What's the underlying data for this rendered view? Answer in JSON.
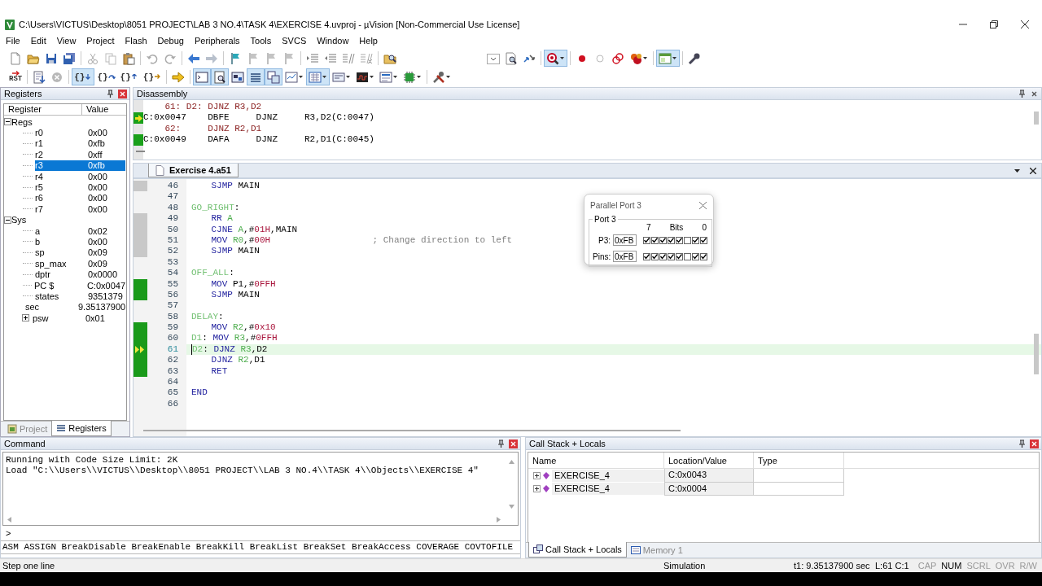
{
  "window": {
    "title": "C:\\Users\\VICTUS\\Desktop\\8051 PROJECT\\LAB 3 NO.4\\TASK 4\\EXERCISE 4.uvproj - µVision  [Non-Commercial Use License]"
  },
  "menu": [
    "File",
    "Edit",
    "View",
    "Project",
    "Flash",
    "Debug",
    "Peripherals",
    "Tools",
    "SVCS",
    "Window",
    "Help"
  ],
  "toolbars": [
    [
      {
        "kind": "new",
        "pressed": false,
        "dropdown": false
      },
      {
        "kind": "open",
        "pressed": false,
        "dropdown": false
      },
      {
        "kind": "save",
        "pressed": false,
        "dropdown": false
      },
      {
        "kind": "saveall",
        "pressed": false,
        "dropdown": false
      },
      {
        "kind": "sep"
      },
      {
        "kind": "cut",
        "pressed": false,
        "dropdown": false
      },
      {
        "kind": "copy",
        "pressed": false,
        "dropdown": false
      },
      {
        "kind": "paste",
        "pressed": false,
        "dropdown": false
      },
      {
        "kind": "sep"
      },
      {
        "kind": "undo",
        "pressed": false,
        "dropdown": false
      },
      {
        "kind": "redo",
        "pressed": false,
        "dropdown": false
      },
      {
        "kind": "sep"
      },
      {
        "kind": "back",
        "pressed": false,
        "dropdown": false
      },
      {
        "kind": "forward",
        "pressed": false,
        "dropdown": false
      },
      {
        "kind": "sep"
      },
      {
        "kind": "flag",
        "pressed": false,
        "dropdown": false
      },
      {
        "kind": "flaggray",
        "pressed": false,
        "dropdown": false
      },
      {
        "kind": "flaggray",
        "pressed": false,
        "dropdown": false
      },
      {
        "kind": "flaggray",
        "pressed": false,
        "dropdown": false
      },
      {
        "kind": "sep"
      },
      {
        "kind": "indent",
        "pressed": false,
        "dropdown": false
      },
      {
        "kind": "outdent",
        "pressed": false,
        "dropdown": false
      },
      {
        "kind": "comment",
        "pressed": false,
        "dropdown": false
      },
      {
        "kind": "uncomment",
        "pressed": false,
        "dropdown": false
      },
      {
        "kind": "sep"
      },
      {
        "kind": "findfiles",
        "pressed": false,
        "dropdown": false
      },
      {
        "kind": "spacer"
      },
      {
        "kind": "combo",
        "pressed": false,
        "dropdown": false
      },
      {
        "kind": "find",
        "pressed": false,
        "dropdown": false
      },
      {
        "kind": "arrows",
        "pressed": false,
        "dropdown": false
      },
      {
        "kind": "sep"
      },
      {
        "kind": "debug",
        "pressed": true,
        "dropdown": true
      },
      {
        "kind": "sep"
      },
      {
        "kind": "breakpoint",
        "pressed": false,
        "dropdown": false
      },
      {
        "kind": "circle",
        "pressed": false,
        "dropdown": false
      },
      {
        "kind": "linked",
        "pressed": false,
        "dropdown": false
      },
      {
        "kind": "multibreak",
        "pressed": false,
        "dropdown": true
      },
      {
        "kind": "sep"
      },
      {
        "kind": "window",
        "pressed": true,
        "dropdown": true
      },
      {
        "kind": "sep"
      },
      {
        "kind": "wrench",
        "pressed": false,
        "dropdown": false
      }
    ],
    [
      {
        "kind": "reset",
        "label": "RST",
        "pressed": false,
        "dropdown": false
      },
      {
        "kind": "sep"
      },
      {
        "kind": "load",
        "pressed": false,
        "dropdown": false
      },
      {
        "kind": "stop",
        "pressed": false,
        "dropdown": false
      },
      {
        "kind": "sep"
      },
      {
        "kind": "step_into",
        "label": "{}",
        "pressed": true,
        "dropdown": false
      },
      {
        "kind": "step_over",
        "label": "{}",
        "pressed": false,
        "dropdown": false
      },
      {
        "kind": "step_out",
        "label": "{}",
        "pressed": false,
        "dropdown": false
      },
      {
        "kind": "run_cursor",
        "label": "{}",
        "pressed": false,
        "dropdown": false
      },
      {
        "kind": "sep"
      },
      {
        "kind": "runarrow",
        "pressed": false,
        "dropdown": false
      },
      {
        "kind": "sep"
      },
      {
        "kind": "terminal",
        "pressed": true,
        "dropdown": false
      },
      {
        "kind": "disasm",
        "pressed": true,
        "dropdown": false
      },
      {
        "kind": "symbols",
        "pressed": false,
        "dropdown": false
      },
      {
        "kind": "registers",
        "pressed": true,
        "dropdown": false
      },
      {
        "kind": "callstack",
        "pressed": true,
        "dropdown": false
      },
      {
        "kind": "watch",
        "pressed": false,
        "dropdown": true
      },
      {
        "kind": "memory",
        "pressed": true,
        "dropdown": true
      },
      {
        "kind": "serial",
        "pressed": false,
        "dropdown": true
      },
      {
        "kind": "analyzer",
        "pressed": false,
        "dropdown": true
      },
      {
        "kind": "trace",
        "pressed": false,
        "dropdown": true
      },
      {
        "kind": "chip",
        "pressed": false,
        "dropdown": true
      },
      {
        "kind": "sep"
      },
      {
        "kind": "tools",
        "pressed": false,
        "dropdown": true
      }
    ]
  ],
  "registers": {
    "title": "Registers",
    "columns": [
      "Register",
      "Value"
    ],
    "groups": [
      {
        "name": "Regs",
        "expanded": true,
        "children": [
          {
            "name": "r0",
            "value": "0x00",
            "selected": false
          },
          {
            "name": "r1",
            "value": "0xfb",
            "selected": false
          },
          {
            "name": "r2",
            "value": "0xff",
            "selected": false
          },
          {
            "name": "r3",
            "value": "0xfb",
            "selected": true
          },
          {
            "name": "r4",
            "value": "0x00",
            "selected": false
          },
          {
            "name": "r5",
            "value": "0x00",
            "selected": false
          },
          {
            "name": "r6",
            "value": "0x00",
            "selected": false
          },
          {
            "name": "r7",
            "value": "0x00",
            "selected": false
          }
        ]
      },
      {
        "name": "Sys",
        "expanded": true,
        "children": [
          {
            "name": "a",
            "value": "0x02",
            "selected": false
          },
          {
            "name": "b",
            "value": "0x00",
            "selected": false
          },
          {
            "name": "sp",
            "value": "0x09",
            "selected": false
          },
          {
            "name": "sp_max",
            "value": "0x09",
            "selected": false
          },
          {
            "name": "dptr",
            "value": "0x0000",
            "selected": false
          },
          {
            "name": "PC  $",
            "value": "C:0x0047",
            "selected": false
          },
          {
            "name": "states",
            "value": "9351379",
            "selected": false
          },
          {
            "name": "sec",
            "value": "9.35137900",
            "selected": false
          },
          {
            "name": "psw",
            "value": "0x01",
            "selected": false,
            "expanded": false
          }
        ]
      }
    ],
    "tabs": [
      {
        "label": "Project",
        "selected": false
      },
      {
        "label": "Registers",
        "selected": true
      }
    ]
  },
  "disassembly": {
    "title": "Disassembly",
    "lines": [
      {
        "kind": "source",
        "number": "61:",
        "text": "D2: DJNZ R3,D2"
      },
      {
        "kind": "asm",
        "address": "C:0x0047",
        "opcode": "DBFE",
        "mnemonic": "DJNZ",
        "operands": "R3,D2(C:0047)",
        "current": true,
        "executed": true
      },
      {
        "kind": "source",
        "number": "62:",
        "text": "    DJNZ R2,D1"
      },
      {
        "kind": "asm",
        "address": "C:0x0049",
        "opcode": "DAFA",
        "mnemonic": "DJNZ",
        "operands": "R2,D1(C:0045)",
        "current": false,
        "executed": true
      }
    ]
  },
  "editor": {
    "tabs": [
      {
        "label": "Exercise 4.a51",
        "selected": true
      }
    ],
    "lines": [
      {
        "number": "46",
        "executed": false,
        "partial": true,
        "current": false,
        "indent": true,
        "tokens": [
          {
            "kind": "keyword",
            "text": "SJMP"
          },
          {
            "kind": "plain",
            "text": " MAIN"
          }
        ]
      },
      {
        "number": "47",
        "executed": false,
        "partial": false,
        "current": false
      },
      {
        "number": "48",
        "executed": false,
        "partial": false,
        "current": false,
        "indent": false,
        "tokens": [
          {
            "kind": "label",
            "text": "GO_RIGHT"
          },
          {
            "kind": "plain",
            "text": ":"
          }
        ]
      },
      {
        "number": "49",
        "executed": false,
        "partial": true,
        "current": false,
        "indent": true,
        "tokens": [
          {
            "kind": "keyword",
            "text": "RR"
          },
          {
            "kind": "register",
            "text": "A"
          }
        ]
      },
      {
        "number": "50",
        "executed": false,
        "partial": true,
        "current": false,
        "indent": true,
        "tokens": [
          {
            "kind": "keyword",
            "text": "CJNE"
          },
          {
            "kind": "register",
            "text": "A"
          },
          {
            "kind": "plain",
            "text": ",#"
          },
          {
            "kind": "number",
            "text": "01H"
          },
          {
            "kind": "plain",
            "text": ",MAIN"
          }
        ]
      },
      {
        "number": "51",
        "executed": false,
        "partial": true,
        "current": false,
        "indent": true,
        "tokens": [
          {
            "kind": "keyword",
            "text": "MOV"
          },
          {
            "kind": "register",
            "text": "R0"
          },
          {
            "kind": "plain",
            "text": ",#"
          },
          {
            "kind": "number",
            "text": "00H"
          },
          {
            "kind": "comment",
            "text": "; Change direction to left"
          }
        ]
      },
      {
        "number": "52",
        "executed": false,
        "partial": true,
        "current": false,
        "indent": true,
        "tokens": [
          {
            "kind": "keyword",
            "text": "SJMP"
          },
          {
            "kind": "plain",
            "text": " MAIN"
          }
        ]
      },
      {
        "number": "53",
        "executed": false,
        "partial": false,
        "current": false
      },
      {
        "number": "54",
        "executed": false,
        "partial": false,
        "current": false,
        "indent": false,
        "tokens": [
          {
            "kind": "label",
            "text": "OFF_ALL"
          },
          {
            "kind": "plain",
            "text": ":"
          }
        ]
      },
      {
        "number": "55",
        "executed": true,
        "partial": false,
        "current": false,
        "indent": true,
        "tokens": [
          {
            "kind": "keyword",
            "text": "MOV"
          },
          {
            "kind": "plain",
            "text": " P1,#"
          },
          {
            "kind": "number",
            "text": "0FFH"
          }
        ]
      },
      {
        "number": "56",
        "executed": true,
        "partial": false,
        "current": false,
        "indent": true,
        "tokens": [
          {
            "kind": "keyword",
            "text": "SJMP"
          },
          {
            "kind": "plain",
            "text": " MAIN"
          }
        ]
      },
      {
        "number": "57",
        "executed": false,
        "partial": false,
        "current": false
      },
      {
        "number": "58",
        "executed": false,
        "partial": false,
        "current": false,
        "indent": false,
        "tokens": [
          {
            "kind": "label",
            "text": "DELAY"
          },
          {
            "kind": "plain",
            "text": ":"
          }
        ]
      },
      {
        "number": "59",
        "executed": true,
        "partial": false,
        "current": false,
        "indent": true,
        "tokens": [
          {
            "kind": "keyword",
            "text": "MOV"
          },
          {
            "kind": "register",
            "text": "R2"
          },
          {
            "kind": "plain",
            "text": ",#"
          },
          {
            "kind": "number",
            "text": "0x10"
          }
        ]
      },
      {
        "number": "60",
        "executed": true,
        "partial": false,
        "current": false,
        "indent": false,
        "tokens": [
          {
            "kind": "label",
            "text": "D1"
          },
          {
            "kind": "plain",
            "text": ": "
          },
          {
            "kind": "keyword",
            "text": "MOV"
          },
          {
            "kind": "register",
            "text": "R3"
          },
          {
            "kind": "plain",
            "text": ",#"
          },
          {
            "kind": "number",
            "text": "0FFH"
          }
        ]
      },
      {
        "number": "61",
        "executed": true,
        "partial": false,
        "current": true,
        "indent": false,
        "tokens": [
          {
            "kind": "label",
            "text": "D2"
          },
          {
            "kind": "plain",
            "text": ": "
          },
          {
            "kind": "keyword",
            "text": "DJNZ"
          },
          {
            "kind": "register",
            "text": "R3"
          },
          {
            "kind": "plain",
            "text": ",D2"
          }
        ]
      },
      {
        "number": "62",
        "executed": true,
        "partial": false,
        "current": false,
        "indent": true,
        "tokens": [
          {
            "kind": "keyword",
            "text": "DJNZ"
          },
          {
            "kind": "register",
            "text": "R2"
          },
          {
            "kind": "plain",
            "text": ",D1"
          }
        ]
      },
      {
        "number": "63",
        "executed": true,
        "partial": false,
        "current": false,
        "indent": true,
        "tokens": [
          {
            "kind": "keyword",
            "text": "RET"
          }
        ]
      },
      {
        "number": "64",
        "executed": false,
        "partial": false,
        "current": false
      },
      {
        "number": "65",
        "executed": false,
        "partial": false,
        "current": false,
        "indent": false,
        "tokens": [
          {
            "kind": "keyword",
            "text": "END"
          }
        ]
      },
      {
        "number": "66",
        "executed": false,
        "partial": false,
        "current": false
      }
    ]
  },
  "port_dialog": {
    "title": "Parallel Port 3",
    "group": "Port 3",
    "bit_high": "7",
    "bits_label": "Bits",
    "bit_low": "0",
    "rows": [
      {
        "label": "P3:",
        "value": "0xFB",
        "bits": [
          {
            "checked": true
          },
          {
            "checked": true
          },
          {
            "checked": true
          },
          {
            "checked": true
          },
          {
            "checked": true
          },
          {
            "checked": false
          },
          {
            "checked": true
          },
          {
            "checked": true
          }
        ]
      },
      {
        "label": "Pins:",
        "value": "0xFB",
        "bits": [
          {
            "checked": true
          },
          {
            "checked": true
          },
          {
            "checked": true
          },
          {
            "checked": true
          },
          {
            "checked": true
          },
          {
            "checked": false
          },
          {
            "checked": true
          },
          {
            "checked": true
          }
        ]
      }
    ]
  },
  "command": {
    "title": "Command",
    "output": [
      "Running with Code Size Limit: 2K",
      "Load \"C:\\\\Users\\\\VICTUS\\\\Desktop\\\\8051 PROJECT\\\\LAB 3 NO.4\\\\TASK 4\\\\Objects\\\\EXERCISE 4\""
    ],
    "prompt": ">",
    "hints": "ASM ASSIGN BreakDisable BreakEnable BreakKill BreakList BreakSet BreakAccess COVERAGE COVTOFILE"
  },
  "call_stack": {
    "title": "Call Stack + Locals",
    "columns": [
      "Name",
      "Location/Value",
      "Type"
    ],
    "rows": [
      {
        "name": "EXERCISE_4",
        "location": "C:0x0043",
        "expanded": false
      },
      {
        "name": "EXERCISE_4",
        "location": "C:0x0004",
        "expanded": false
      }
    ],
    "tabs": [
      {
        "label": "Call Stack + Locals",
        "selected": true
      },
      {
        "label": "Memory 1",
        "selected": false
      }
    ]
  },
  "status_bar": {
    "hint": "Step one line",
    "mode": "Simulation",
    "time": "t1: 9.35137900 sec",
    "position": "L:61 C:1",
    "indicators": [
      {
        "label": "CAP",
        "on": false
      },
      {
        "label": "NUM",
        "on": true
      },
      {
        "label": "SCRL",
        "on": false
      },
      {
        "label": "OVR",
        "on": false
      },
      {
        "label": "R/W",
        "on": false
      }
    ]
  }
}
